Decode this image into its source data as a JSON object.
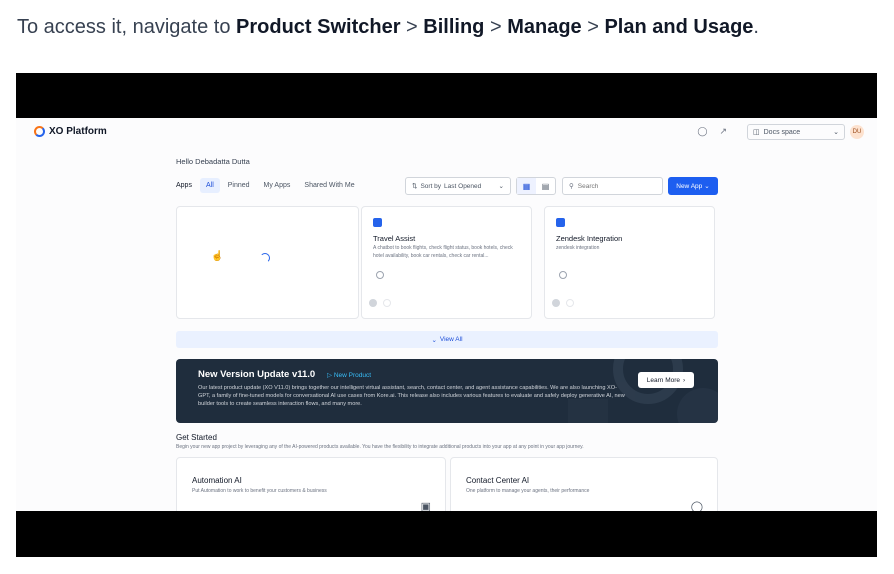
{
  "intro": {
    "prefix": "To access it, navigate to ",
    "step1": "Product Switcher",
    "sep": " > ",
    "step2": "Billing",
    "step3": "Manage",
    "step4": "Plan and Usage",
    "suffix": "."
  },
  "app": {
    "logo": "XO Platform",
    "workspace": "Docs space",
    "avatar": "DU",
    "greeting": "Hello Debadatta Dutta"
  },
  "filters": {
    "label": "Apps",
    "chips": [
      "All",
      "Pinned",
      "My Apps",
      "Shared With Me"
    ],
    "sort_prefix": "Sort by",
    "sort_value": "Last Opened",
    "search_placeholder": "Search",
    "new_app": "New App"
  },
  "cards": [
    {
      "title": "",
      "desc": ""
    },
    {
      "title": "Travel Assist",
      "desc": "A chatbot to book flights, check flight status, book hotels, check hotel availability, book car rentals, check car rental..."
    },
    {
      "title": "Zendesk Integration",
      "desc": "zendesk integration"
    }
  ],
  "view_all": "View All",
  "banner": {
    "title": "New Version Update v11.0",
    "badge": "New Product",
    "body": "Our latest product update (XO V11.0) brings together our intelligent virtual assistant, search, contact center, and agent assistance capabilities. We are also launching XO-GPT, a family of fine-tuned models for conversational AI use cases from Kore.ai. This release also includes various features to evaluate and safely deploy generative AI, new builder tools to create seamless interaction flows, and many more.",
    "cta": "Learn More"
  },
  "get_started": {
    "title": "Get Started",
    "subtitle": "Begin your new app project by leveraging any of the AI-powered products available. You have the flexibility to integrate additional products into your app at any point in your app journey.",
    "cards": [
      {
        "title": "Automation AI",
        "desc": "Put Automation to work to benefit your customers & business"
      },
      {
        "title": "Contact Center AI",
        "desc": "One platform to manage your agents, their performance"
      }
    ]
  },
  "colors": {
    "primary": "#1d5ef0",
    "banner_bg": "#1f2d3d",
    "badge": "#38bdf8",
    "logo_orange": "#f97316"
  }
}
